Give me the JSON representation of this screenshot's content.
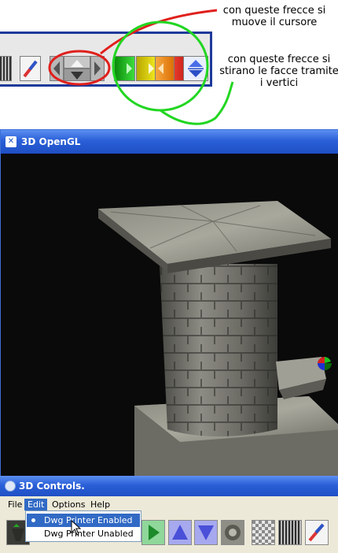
{
  "annotations": {
    "red_note": "con queste frecce si muove il cursore",
    "green_note": "con queste frecce si stirano le facce tramite i vertici",
    "colors": {
      "red": "#e0201c",
      "green": "#22d622",
      "toolbar_border": "#1e3a9a"
    }
  },
  "annotated_toolbar": {
    "icons": [
      "grid-texture-icon",
      "brush-icon",
      "arrow-left-icon",
      "arrow-up-icon",
      "arrow-down-icon",
      "arrow-right-icon",
      "green-arrow-icon",
      "yellow-arrow-icon",
      "orange-arrow-icon",
      "red-arrow-icon",
      "blue-up-down-icon"
    ]
  },
  "gl_window": {
    "title": "3D OpenGL",
    "icon": "app-logo-icon",
    "colors": {
      "titlebar": "#2a5fd8",
      "viewport": "#0a0a0a"
    }
  },
  "controls_window": {
    "title": "3D Controls.",
    "menu": [
      {
        "label": "File",
        "active": false
      },
      {
        "label": "Edit",
        "active": true
      },
      {
        "label": "Options",
        "active": false
      },
      {
        "label": "Help",
        "active": false
      }
    ],
    "edit_menu": [
      {
        "label": "Dwg Printer Enabled",
        "checked": true,
        "highlighted": true
      },
      {
        "label": "Dwg Printer Unabled",
        "checked": false,
        "highlighted": false
      }
    ],
    "toolbar_icons": [
      "paint-bucket-icon",
      "play-icon",
      "triangle-up-icon",
      "triangle-down-icon",
      "circle-icon",
      "checker-texture-icon",
      "grid-texture-icon",
      "brush-icon"
    ]
  }
}
